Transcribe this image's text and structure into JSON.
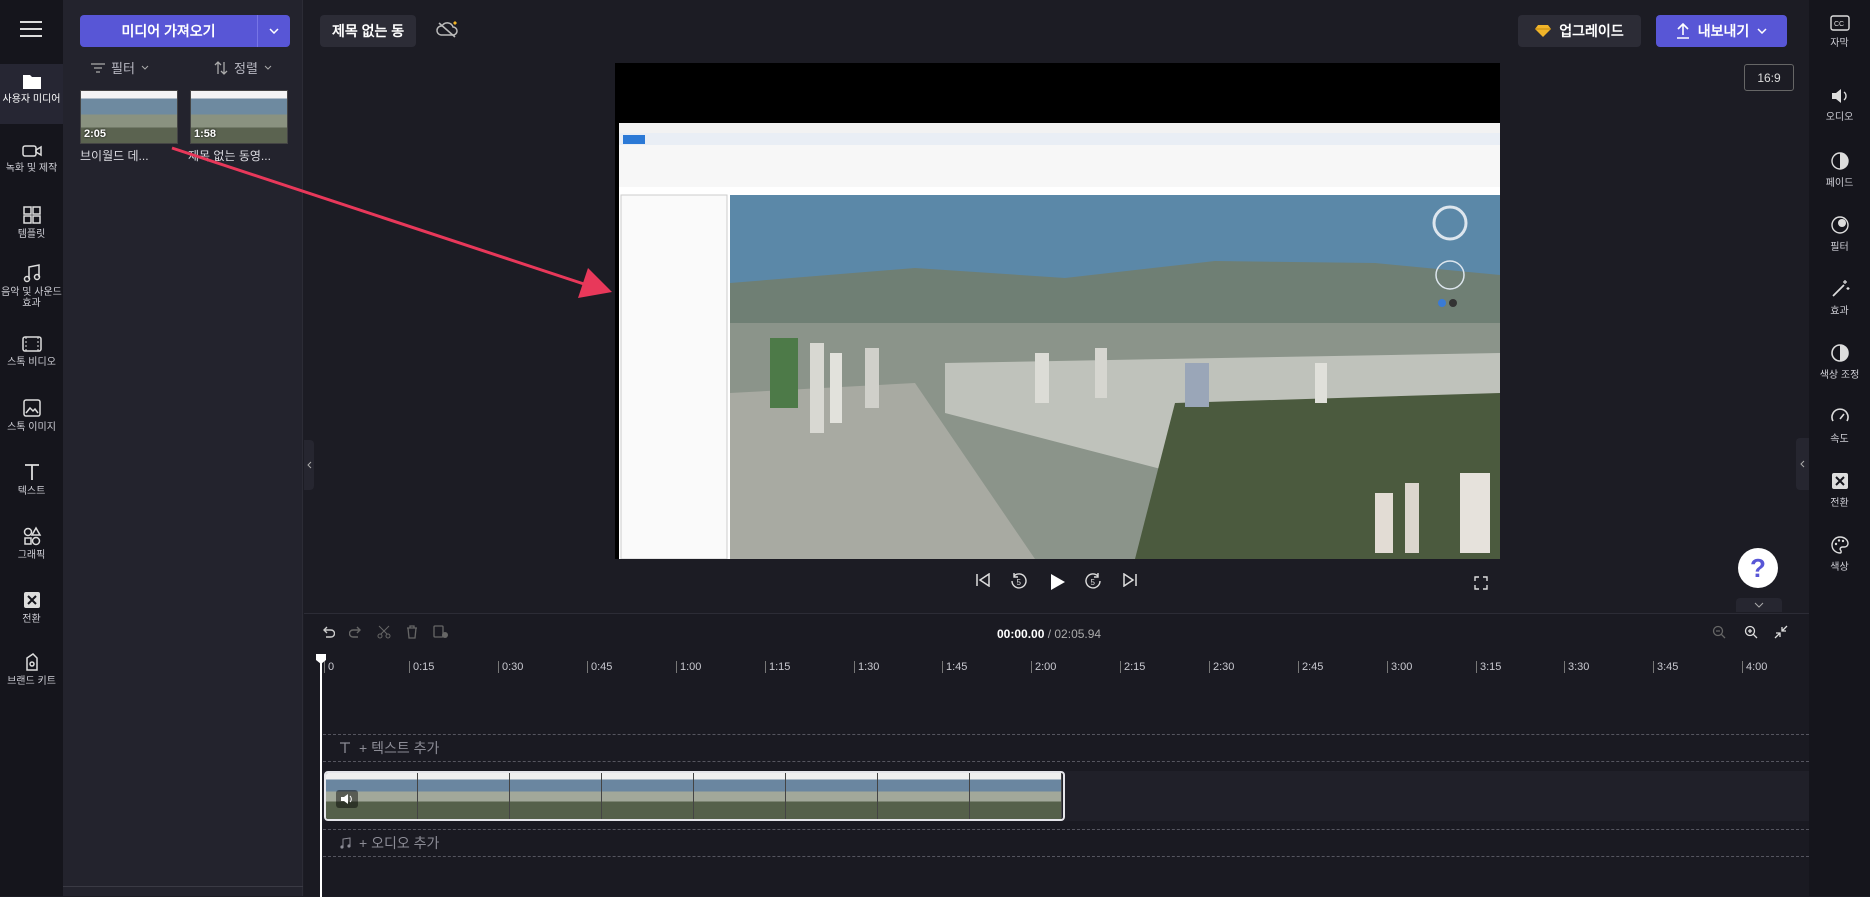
{
  "leftnav": {
    "items": [
      {
        "label": "사용자 미디어",
        "icon": "folder-icon"
      },
      {
        "label": "녹화 및 제작",
        "icon": "video-camera-icon"
      },
      {
        "label": "템플릿",
        "icon": "template-icon"
      },
      {
        "label": "음악 및 사운드 효과",
        "icon": "music-note-icon"
      },
      {
        "label": "스톡 비디오",
        "icon": "film-icon"
      },
      {
        "label": "스톡 이미지",
        "icon": "image-icon"
      },
      {
        "label": "텍스트",
        "icon": "text-icon"
      },
      {
        "label": "그래픽",
        "icon": "shapes-icon"
      },
      {
        "label": "전환",
        "icon": "transition-icon"
      },
      {
        "label": "브랜드 키트",
        "icon": "brand-kit-icon"
      }
    ]
  },
  "media": {
    "import_label": "미디어 가져오기",
    "filter_label": "필터",
    "sort_label": "정렬",
    "items": [
      {
        "name": "브이월드 데...",
        "duration": "2:05"
      },
      {
        "name": "제목 없는 동영...",
        "duration": "1:58"
      }
    ]
  },
  "header": {
    "title": "제목 없는 동",
    "upgrade_label": "업그레이드",
    "export_label": "내보내기"
  },
  "preview": {
    "aspect": "16:9"
  },
  "player": {
    "current_time": "00:00.00",
    "total_time": "/ 02:05.94"
  },
  "timeline": {
    "ticks": [
      "0",
      "0:15",
      "0:30",
      "0:45",
      "1:00",
      "1:15",
      "1:30",
      "1:45",
      "2:00",
      "2:15",
      "2:30",
      "2:45",
      "3:00",
      "3:15",
      "3:30",
      "3:45",
      "4:00"
    ],
    "add_text": "+ 텍스트 추가",
    "add_audio": "+ 오디오 추가"
  },
  "rightnav": {
    "items": [
      {
        "label": "자막",
        "icon": "cc-icon"
      },
      {
        "label": "오디오",
        "icon": "speaker-icon"
      },
      {
        "label": "페이드",
        "icon": "fade-icon"
      },
      {
        "label": "필터",
        "icon": "filter-icon"
      },
      {
        "label": "효과",
        "icon": "magic-wand-icon"
      },
      {
        "label": "색상 조정",
        "icon": "contrast-icon"
      },
      {
        "label": "속도",
        "icon": "speedometer-icon"
      },
      {
        "label": "전환",
        "icon": "transition-icon"
      },
      {
        "label": "색상",
        "icon": "palette-icon"
      }
    ]
  },
  "help": {
    "label": "?"
  },
  "colors": {
    "accent": "#5856d6",
    "arrow": "#e8385a"
  }
}
